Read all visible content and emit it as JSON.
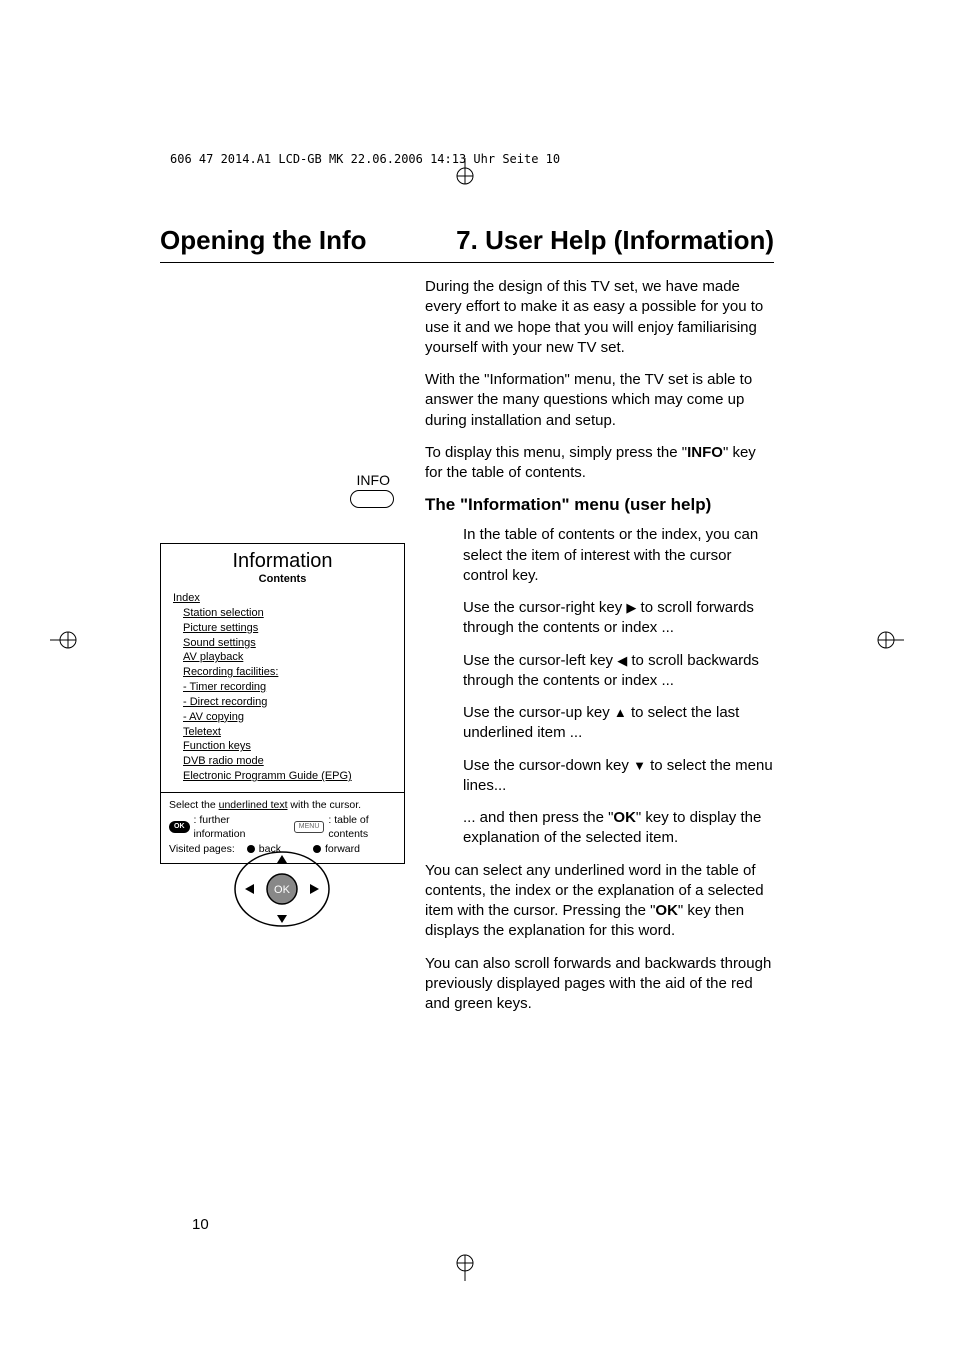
{
  "header": {
    "print_line": "606 47 2014.A1 LCD-GB  MK  22.06.2006  14:13 Uhr  Seite 10"
  },
  "titles": {
    "left": "Opening the Info",
    "right": "7. User Help (Information)"
  },
  "info_button": {
    "label": "INFO"
  },
  "menu": {
    "title": "Information",
    "subtitle": "Contents",
    "items": {
      "index": "Index",
      "station": "Station selection",
      "picture": "Picture settings",
      "sound": "Sound settings",
      "av_playback": "AV playback",
      "recording": "Recording facilities:",
      "timer": "- Timer recording",
      "direct": "- Direct recording",
      "av_copying": "- AV copying",
      "teletext": "Teletext",
      "function_keys": "Function keys",
      "dvb_radio": "DVB radio mode",
      "epg": "Electronic Programm Guide (EPG)"
    },
    "footer": {
      "line1a": "Select the ",
      "line1b": "underlined text",
      "line1c": " with the cursor.",
      "line2_left": " : further information",
      "line2_right": ": table of contents",
      "line3_left": "Visited pages:",
      "line3_back": "back",
      "line3_forward": "forward"
    }
  },
  "body": {
    "p1": "During the design of this TV set, we have made every effort to make it as easy a possible for you to use it and we hope that you will enjoy familiarising yourself with your new TV set.",
    "p2": "With the \"Information\" menu, the TV set is able to answer the many questions which may come up during installation and setup.",
    "p3a": "To display this menu, simply press the \"",
    "p3b": "INFO",
    "p3c": "\" key for the table of contents.",
    "subheading": "The \"Information\" menu (user help)",
    "p4": "In the table of contents or the index, you can select the item of interest with the cursor control key.",
    "p5a": "Use the cursor-right key ",
    "p5b": " to scroll forwards through the contents or index ...",
    "p6a": "Use the cursor-left key ",
    "p6b": " to scroll backwards through the contents or index ...",
    "p7a": "Use the cursor-up key ",
    "p7b": " to select the last underlined item ...",
    "p8a": "Use the cursor-down key ",
    "p8b": " to select the menu lines...",
    "p9a": "... and then press the \"",
    "p9b": "OK",
    "p9c": "\" key to display the explanation of the selected item.",
    "p10a": "You can select any underlined word in the table of contents, the index or the explanation of a selected item with the cursor. Pressing the \"",
    "p10b": "OK",
    "p10c": "\" key then displays the explanation for this word.",
    "p11": "You can also scroll forwards and backwards through previously displayed pages with the aid of the red and green keys."
  },
  "arrows": {
    "right": "▶",
    "left": "◀",
    "up": "▲",
    "down": "▼"
  },
  "page_number": "10"
}
